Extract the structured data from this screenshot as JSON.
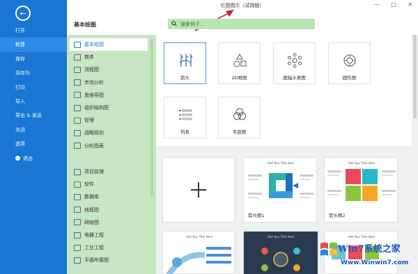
{
  "window": {
    "title": "亿图图示（试用版）",
    "minimize": "—",
    "maximize": "▢",
    "close": "✕"
  },
  "nav": {
    "back": "←",
    "items": [
      "打开",
      "新建",
      "保存",
      "另存为",
      "打印",
      "导入",
      "导出 & 发送",
      "关闭",
      "选项"
    ],
    "exit": "退出",
    "active_index": 1
  },
  "category": {
    "heading": "基本绘图",
    "items": [
      "基本绘图",
      "商务",
      "流程图",
      "市场分析",
      "思维导图",
      "组织结构图",
      "管理",
      "战略规划",
      "分析图表"
    ],
    "items2": [
      "项目管理",
      "软件",
      "数据库",
      "线框图",
      "网络图",
      "电器工程",
      "工业工程",
      "平面布置图"
    ],
    "active_index": 0
  },
  "search": {
    "placeholder": "搜索例子..."
  },
  "templates": [
    {
      "label": "箭头",
      "icon": "arrow-shapes-icon"
    },
    {
      "label": "2D框图",
      "icon": "shapes-2d-icon"
    },
    {
      "label": "圆辐示意图",
      "icon": "radial-diagram-icon"
    },
    {
      "label": "圆形图",
      "icon": "circle-diagram-icon"
    },
    {
      "label": "列表",
      "icon": "list-icon"
    },
    {
      "label": "韦恩图",
      "icon": "venn-icon"
    }
  ],
  "examples": [
    {
      "label": "",
      "kind": "new-blank"
    },
    {
      "label": "箭头图1",
      "header": "Add Your Title Here"
    },
    {
      "label": "箭头图2",
      "header": "Add Your Title Here"
    },
    {
      "label": "",
      "header": "Add Your Title Here"
    },
    {
      "label": "",
      "header": "Add Your Title Here"
    },
    {
      "label": "",
      "header": "Add Your Title Here"
    }
  ],
  "watermark": {
    "line1": "Win7系统之家",
    "line2": "Www.Winwin7.com"
  },
  "colors": {
    "nav_blue": "#1976d2",
    "category_green": "#c7e6c3",
    "search_green": "#b8e6b5",
    "accent": "#1a73c8",
    "arrow_red": "#d22020"
  }
}
